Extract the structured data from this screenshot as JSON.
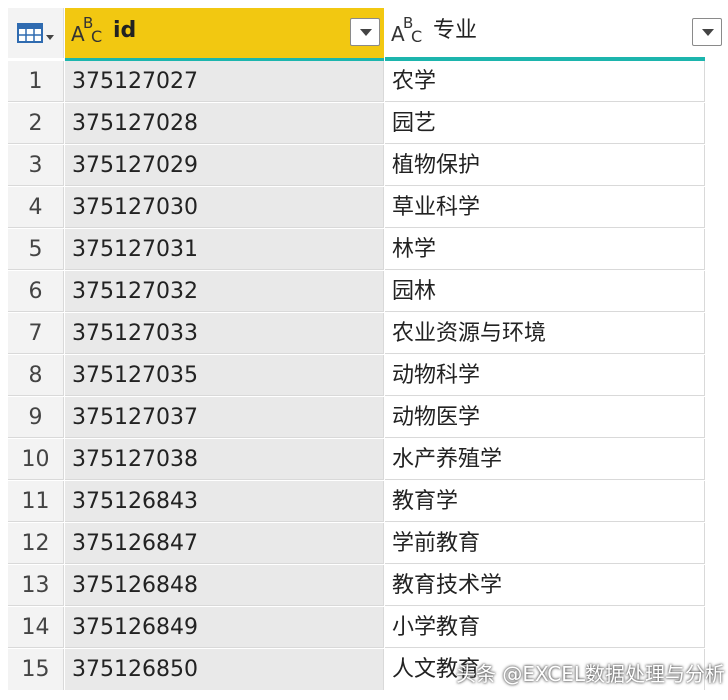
{
  "columns": {
    "id": {
      "type_icon": "text-type-icon",
      "title": "id"
    },
    "major": {
      "type_icon": "text-type-icon",
      "title": "专业"
    }
  },
  "table": {
    "rows": [
      {
        "index": "1",
        "id": "375127027",
        "major": "农学"
      },
      {
        "index": "2",
        "id": "375127028",
        "major": "园艺"
      },
      {
        "index": "3",
        "id": "375127029",
        "major": "植物保护"
      },
      {
        "index": "4",
        "id": "375127030",
        "major": "草业科学"
      },
      {
        "index": "5",
        "id": "375127031",
        "major": "林学"
      },
      {
        "index": "6",
        "id": "375127032",
        "major": "园林"
      },
      {
        "index": "7",
        "id": "375127033",
        "major": "农业资源与环境"
      },
      {
        "index": "8",
        "id": "375127035",
        "major": "动物科学"
      },
      {
        "index": "9",
        "id": "375127037",
        "major": "动物医学"
      },
      {
        "index": "10",
        "id": "375127038",
        "major": "水产养殖学"
      },
      {
        "index": "11",
        "id": "375126843",
        "major": "教育学"
      },
      {
        "index": "12",
        "id": "375126847",
        "major": "学前教育"
      },
      {
        "index": "13",
        "id": "375126848",
        "major": "教育技术学"
      },
      {
        "index": "14",
        "id": "375126849",
        "major": "小学教育"
      },
      {
        "index": "15",
        "id": "375126850",
        "major": "人文教育"
      }
    ]
  },
  "watermark": "头条 @EXCEL数据处理与分析",
  "colors": {
    "selected_header": "#f2c811",
    "quality_bar": "#1cb5ad",
    "selected_column_bg": "#e9e9e9"
  }
}
